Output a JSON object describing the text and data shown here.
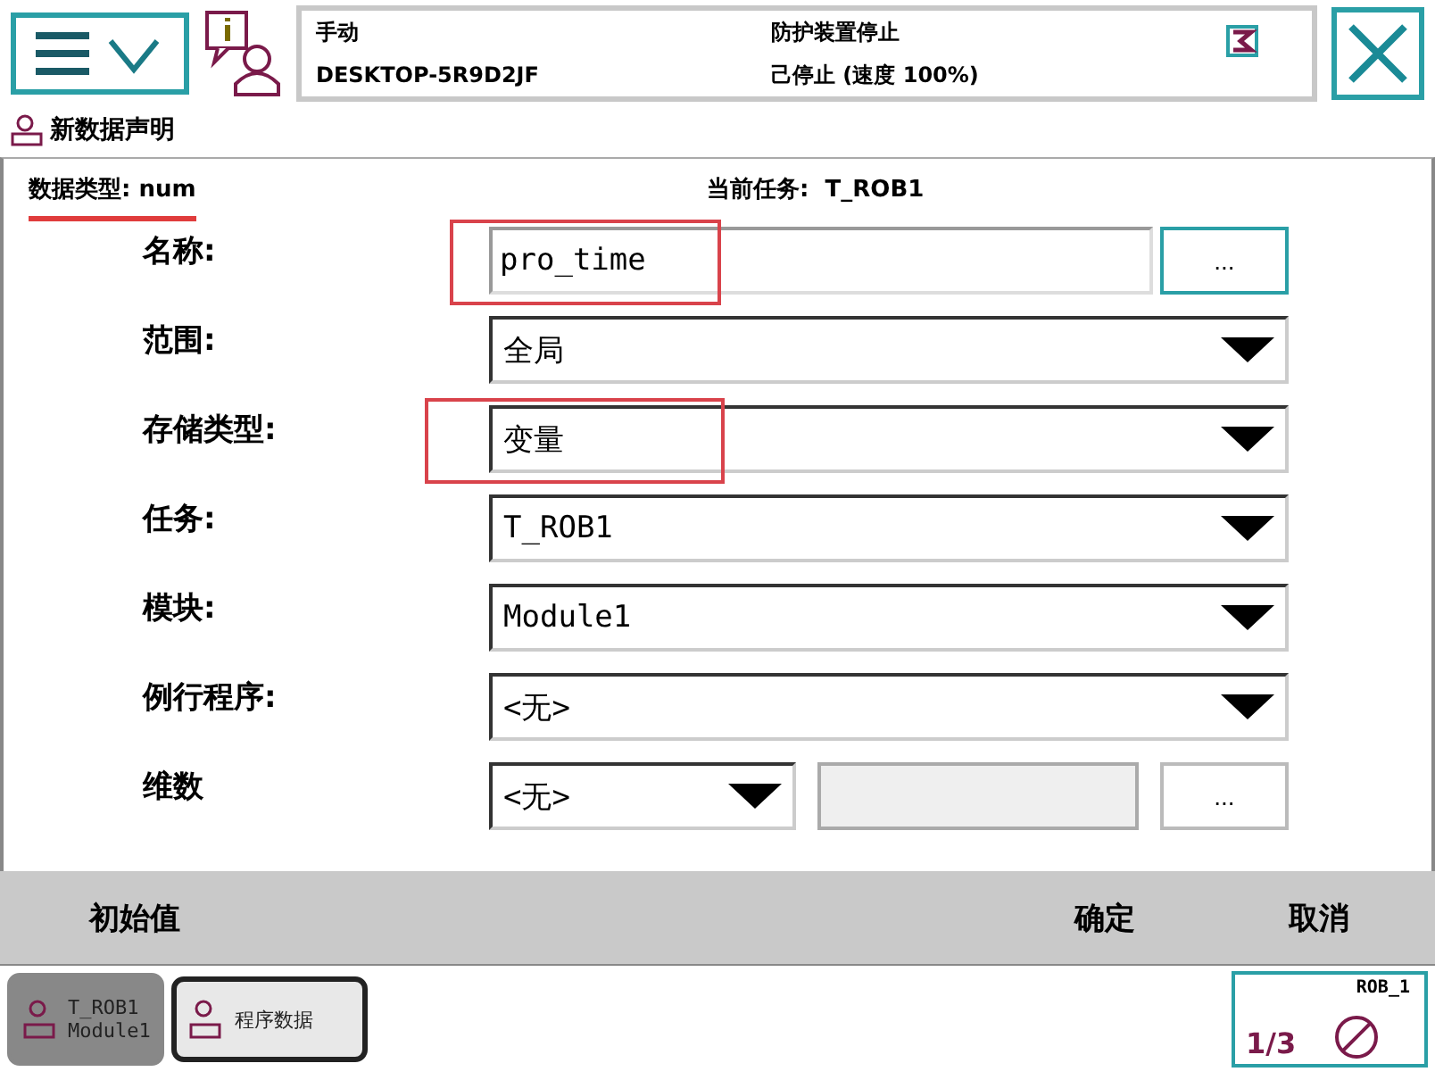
{
  "status": {
    "mode": "手动",
    "controller": "DESKTOP-5R9D2JF",
    "safety": "防护装置停止",
    "state": "己停止 (速度 100%)"
  },
  "page_title": "新数据声明",
  "data_type": {
    "label": "数据类型:",
    "value": "num",
    "underlined": true
  },
  "current_task": {
    "label": "当前任务:",
    "value": "T_ROB1"
  },
  "fields": [
    {
      "kind": "text",
      "label": "名称:",
      "value": "pro_time",
      "button": "...",
      "highlighted": true
    },
    {
      "kind": "dropdown",
      "label": "范围:",
      "value": "全局",
      "highlighted": false
    },
    {
      "kind": "dropdown",
      "label": "存储类型:",
      "value": "变量",
      "highlighted": true
    },
    {
      "kind": "dropdown",
      "label": "任务:",
      "value": "T_ROB1",
      "highlighted": false
    },
    {
      "kind": "dropdown",
      "label": "模块:",
      "value": "Module1",
      "highlighted": false
    },
    {
      "kind": "dropdown",
      "label": "例行程序:",
      "value": "<无>",
      "highlighted": false
    },
    {
      "kind": "dims",
      "label": "维数",
      "value": "<无>",
      "button": "...",
      "highlighted": false
    }
  ],
  "commands": [
    "初始值",
    "确定",
    "取消"
  ],
  "taskbar": [
    {
      "line1": "T_ROB1",
      "line2": "Module1",
      "selected": false
    },
    {
      "line1": "程序数据",
      "selected": true
    }
  ],
  "quickset": {
    "robot": "ROB_1",
    "increment": "1/3"
  }
}
